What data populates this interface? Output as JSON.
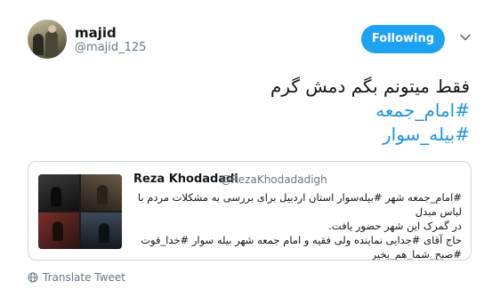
{
  "user": {
    "display_name": "majid",
    "handle": "@majid_125"
  },
  "follow_button": {
    "label": "Following",
    "color": "#1da1f2"
  },
  "tweet": {
    "line1": "فقط میتونم بگم دمش گرم",
    "hashtag1": "#امام_جمعه",
    "hashtag2": "#بیله_سوار",
    "hashtag_color": "#1b95e0"
  },
  "quoted_tweet": {
    "name": "Reza Khodadadi",
    "handle": "@RezaKhodadadigh",
    "text_line1": "#امام_جمعه شهر #بیله‌سوار استان اردبیل برای بررسی به مشکلات مردم با لباس مبدل",
    "text_line2": "در گمرک این شهر حضور یافت.",
    "text_line3": "حاج آقای #جدایی نماینده ولی فقیه و امام جمعه شهر بیله سوار #خدا_قوت",
    "text_line4": "#صبح_شما_هم_بخیر"
  },
  "translate": {
    "label": "Translate Tweet",
    "icon": "globe-icon"
  }
}
